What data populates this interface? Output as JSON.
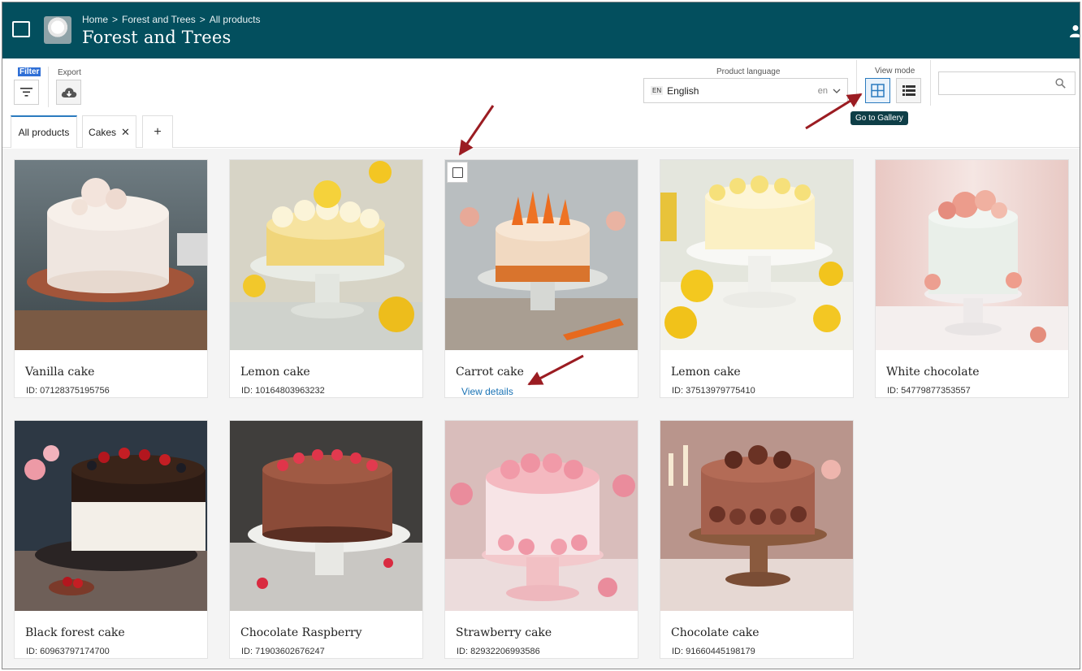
{
  "header": {
    "breadcrumb": [
      "Home",
      "Forest and Trees",
      "All products"
    ],
    "separator": ">",
    "title": "Forest and Trees"
  },
  "toolbar": {
    "filter_label": "Filter",
    "export_label": "Export",
    "language": {
      "label": "Product language",
      "badge": "EN",
      "value": "English",
      "code": "en"
    },
    "view_mode": {
      "label": "View mode",
      "tooltip": "Go to Gallery"
    },
    "search": {
      "placeholder": ""
    }
  },
  "tabs": {
    "all_products": "All products",
    "cakes": "Cakes",
    "close_glyph": "✕",
    "add_glyph": "+"
  },
  "products": [
    {
      "name": "Vanilla cake",
      "id": "ID: 07128375195756",
      "theme": "vanilla"
    },
    {
      "name": "Lemon cake",
      "id": "ID: 10164803963232",
      "theme": "lemon"
    },
    {
      "name": "Carrot cake",
      "link": "View details",
      "theme": "carrot",
      "selectable": true
    },
    {
      "name": "Lemon cake",
      "id": "ID: 37513979775410",
      "theme": "lemon2"
    },
    {
      "name": "White chocolate",
      "id": "ID: 54779877353557",
      "theme": "white"
    },
    {
      "name": "Black forest cake",
      "id": "ID: 60963797174700",
      "theme": "blackforest"
    },
    {
      "name": "Chocolate Raspberry",
      "id": "ID: 71903602676247",
      "theme": "choco-rasp"
    },
    {
      "name": "Strawberry cake",
      "id": "ID: 82932206993586",
      "theme": "strawberry"
    },
    {
      "name": "Chocolate cake",
      "id": "ID: 91660445198179",
      "theme": "chocolate"
    }
  ],
  "colors": {
    "header_bg": "#034f5e",
    "accent": "#2b7bbf",
    "annotation_arrow": "#9b1c22",
    "link": "#1a73b5"
  }
}
